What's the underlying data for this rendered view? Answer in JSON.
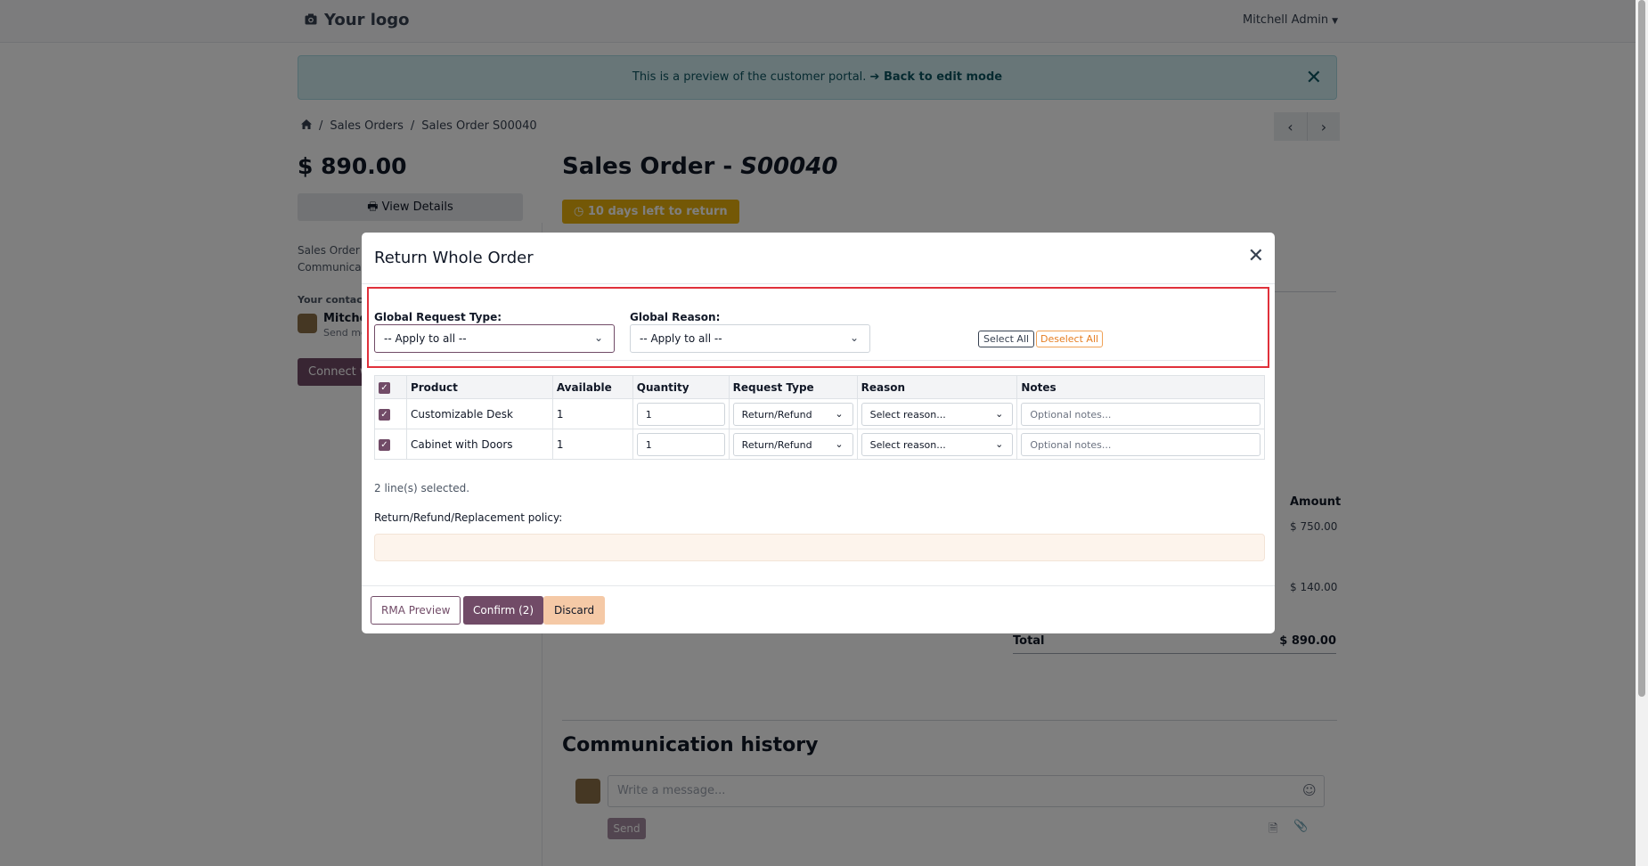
{
  "header": {
    "logo_text": "Your logo",
    "user_name": "Mitchell Admin"
  },
  "banner": {
    "message": "This is a preview of the customer portal.",
    "link": "➔ Back to edit mode"
  },
  "breadcrumb": {
    "items": [
      "Sales Orders",
      "Sales Order S00040"
    ]
  },
  "sidebar": {
    "amount": "$ 890.00",
    "view_details": "View Details",
    "text_line1": "Sales Order -",
    "text_line2": "Communicat",
    "contact_label": "Your contact",
    "contact_name": "Mitchel",
    "contact_sub": "Send me",
    "connect_button": "Connect w"
  },
  "main": {
    "title_prefix": "Sales Order - ",
    "title_ref": "S00040",
    "return_badge": "10 days left to return",
    "amount_header": "Amount",
    "amounts": [
      "$ 750.00",
      "$ 140.00"
    ],
    "total_label": "Total",
    "total_value": "$ 890.00",
    "comm_title": "Communication history",
    "message_placeholder": "Write a message...",
    "send_button": "Send"
  },
  "modal": {
    "title": "Return Whole Order",
    "global_request_type_label": "Global Request Type:",
    "global_request_type_value": "-- Apply to all --",
    "global_reason_label": "Global Reason:",
    "global_reason_value": "-- Apply to all --",
    "select_all": "Select All",
    "deselect_all": "Deselect All",
    "columns": [
      "Product",
      "Available",
      "Quantity",
      "Request Type",
      "Reason",
      "Notes"
    ],
    "rows": [
      {
        "product": "Customizable Desk",
        "available": "1",
        "quantity": "1",
        "request_type": "Return/Refund",
        "reason": "Select reason...",
        "notes_placeholder": "Optional notes..."
      },
      {
        "product": "Cabinet with Doors",
        "available": "1",
        "quantity": "1",
        "request_type": "Return/Refund",
        "reason": "Select reason...",
        "notes_placeholder": "Optional notes..."
      }
    ],
    "selected_count": "2 line(s) selected.",
    "policy_label": "Return/Refund/Replacement policy:",
    "rma_preview": "RMA Preview",
    "confirm": "Confirm (2)",
    "discard": "Discard"
  },
  "colors": {
    "brand": "#714b67",
    "badge": "#e8b00c",
    "highlight": "#e0313b"
  }
}
